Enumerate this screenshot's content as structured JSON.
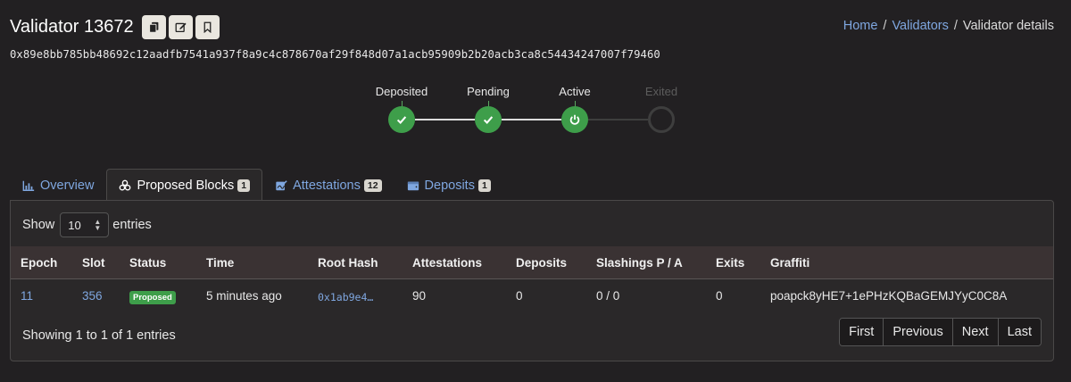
{
  "header": {
    "title": "Validator 13672",
    "address": "0x89e8bb785bb48692c12aadfb7541a937f8a9c4c878670af29f848d07a1acb95909b2b20acb3ca8c54434247007f79460",
    "actions": [
      {
        "icon": "copy-icon"
      },
      {
        "icon": "edit-icon"
      },
      {
        "icon": "bookmark-icon"
      }
    ]
  },
  "breadcrumb": {
    "home": "Home",
    "sep1": "/",
    "validators": "Validators",
    "sep2": "/",
    "current": "Validator details"
  },
  "lifecycle": {
    "steps": [
      {
        "label": "Deposited",
        "state": "done",
        "icon": "check-icon"
      },
      {
        "label": "Pending",
        "state": "done",
        "icon": "check-icon"
      },
      {
        "label": "Active",
        "state": "done",
        "icon": "power-icon"
      },
      {
        "label": "Exited",
        "state": "inactive",
        "icon": ""
      }
    ]
  },
  "tabs": [
    {
      "label": "Overview",
      "icon": "chart-icon",
      "badge": ""
    },
    {
      "label": "Proposed Blocks",
      "icon": "cubes-icon",
      "badge": "1"
    },
    {
      "label": "Attestations",
      "icon": "signature-icon",
      "badge": "12"
    },
    {
      "label": "Deposits",
      "icon": "wallet-icon",
      "badge": "1"
    }
  ],
  "table": {
    "show_label": "Show",
    "entries_label": "entries",
    "page_size": "10",
    "columns": [
      "Epoch",
      "Slot",
      "Status",
      "Time",
      "Root Hash",
      "Attestations",
      "Deposits",
      "Slashings P / A",
      "Exits",
      "Graffiti"
    ],
    "rows": [
      {
        "epoch": "11",
        "slot": "356",
        "status": "Proposed",
        "time": "5 minutes ago",
        "root_hash": "0x1ab9e4…",
        "attestations": "90",
        "deposits": "0",
        "slashings": "0 / 0",
        "exits": "0",
        "graffiti": "poapck8yHE7+1ePHzKQBaGEMJYyC0C8A"
      }
    ],
    "info": "Showing 1 to 1 of 1 entries",
    "pager": {
      "first": "First",
      "previous": "Previous",
      "next": "Next",
      "last": "Last"
    }
  },
  "colors": {
    "background": "#222022",
    "panel": "#2a2829",
    "link": "#7fa7e0",
    "success": "#3e9e4a",
    "table_header": "#3a3233"
  }
}
